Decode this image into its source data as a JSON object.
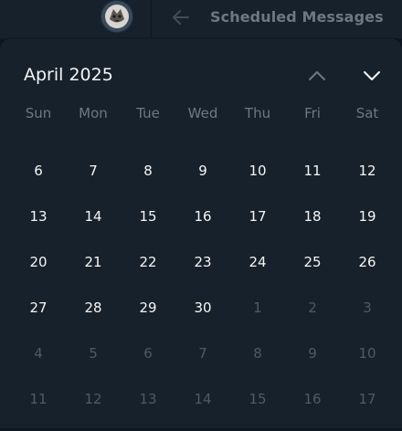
{
  "header": {
    "title": "Scheduled Messages"
  },
  "calendar": {
    "month_label": "April 2025",
    "weekdays": [
      "Sun",
      "Mon",
      "Tue",
      "Wed",
      "Thu",
      "Fri",
      "Sat"
    ],
    "weeks": [
      [
        {
          "label": "",
          "muted": false
        },
        {
          "label": "",
          "muted": false
        },
        {
          "label": "",
          "muted": false
        },
        {
          "label": "",
          "muted": false
        },
        {
          "label": "",
          "muted": false
        },
        {
          "label": "",
          "muted": false
        },
        {
          "label": "",
          "muted": false
        }
      ],
      [
        {
          "label": "6",
          "muted": false
        },
        {
          "label": "7",
          "muted": false
        },
        {
          "label": "8",
          "muted": false
        },
        {
          "label": "9",
          "muted": false
        },
        {
          "label": "10",
          "muted": false
        },
        {
          "label": "11",
          "muted": false
        },
        {
          "label": "12",
          "muted": false
        }
      ],
      [
        {
          "label": "13",
          "muted": false
        },
        {
          "label": "14",
          "muted": false
        },
        {
          "label": "15",
          "muted": false
        },
        {
          "label": "16",
          "muted": false
        },
        {
          "label": "17",
          "muted": false
        },
        {
          "label": "18",
          "muted": false
        },
        {
          "label": "19",
          "muted": false
        }
      ],
      [
        {
          "label": "20",
          "muted": false
        },
        {
          "label": "21",
          "muted": false
        },
        {
          "label": "22",
          "muted": false
        },
        {
          "label": "23",
          "muted": false
        },
        {
          "label": "24",
          "muted": false
        },
        {
          "label": "25",
          "muted": false
        },
        {
          "label": "26",
          "muted": false
        }
      ],
      [
        {
          "label": "27",
          "muted": false
        },
        {
          "label": "28",
          "muted": false
        },
        {
          "label": "29",
          "muted": false
        },
        {
          "label": "30",
          "muted": false
        },
        {
          "label": "1",
          "muted": true
        },
        {
          "label": "2",
          "muted": true
        },
        {
          "label": "3",
          "muted": true
        }
      ],
      [
        {
          "label": "4",
          "muted": true
        },
        {
          "label": "5",
          "muted": true
        },
        {
          "label": "6",
          "muted": true
        },
        {
          "label": "7",
          "muted": true
        },
        {
          "label": "8",
          "muted": true
        },
        {
          "label": "9",
          "muted": true
        },
        {
          "label": "10",
          "muted": true
        }
      ],
      [
        {
          "label": "11",
          "muted": true
        },
        {
          "label": "12",
          "muted": true
        },
        {
          "label": "13",
          "muted": true
        },
        {
          "label": "14",
          "muted": true
        },
        {
          "label": "15",
          "muted": true
        },
        {
          "label": "16",
          "muted": true
        },
        {
          "label": "17",
          "muted": true
        }
      ]
    ]
  },
  "icons": {
    "avatar": "avatar-icon",
    "back": "arrow-left-icon",
    "prev_month": "chevron-up-icon",
    "next_month": "chevron-down-icon"
  },
  "colors": {
    "background": "#0e1621",
    "panel": "#17212b",
    "text_primary": "#f5f5f5",
    "text_muted": "#4e5a66",
    "text_secondary": "#6c7883"
  }
}
